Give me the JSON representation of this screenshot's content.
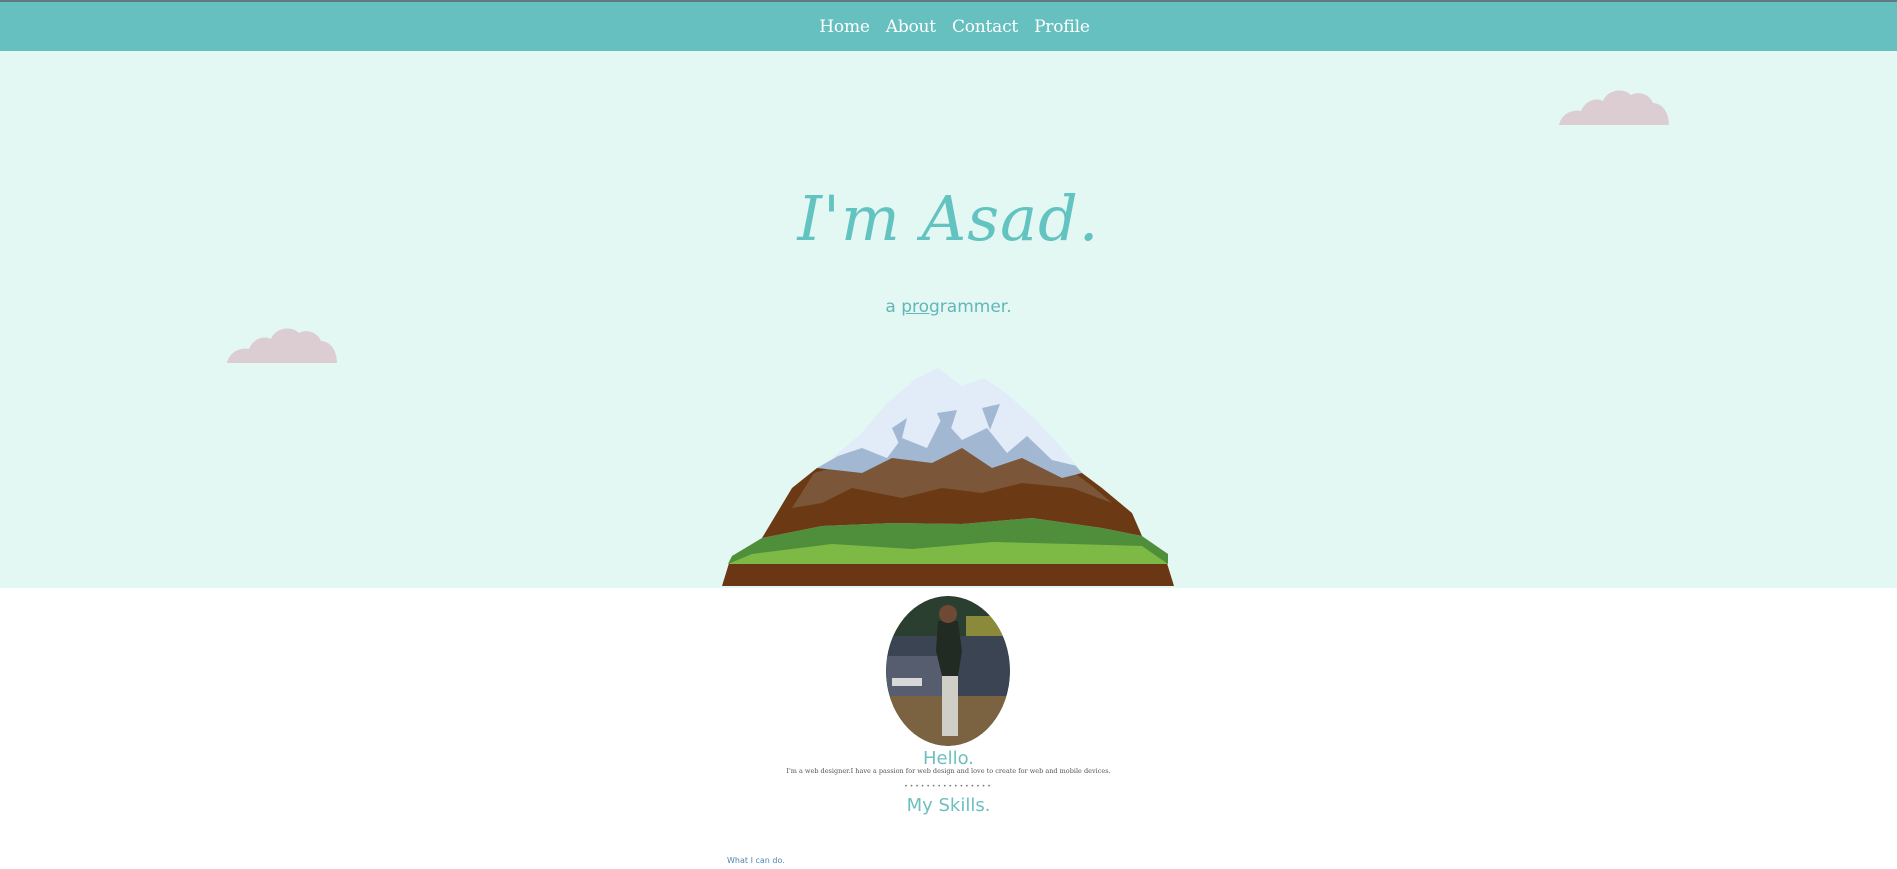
{
  "nav": {
    "items": [
      {
        "label": "Home"
      },
      {
        "label": "About"
      },
      {
        "label": "Contact"
      },
      {
        "label": "Profile"
      }
    ]
  },
  "hero": {
    "title": "I'm Asad.",
    "subtitle_prefix": "a ",
    "subtitle_underlined": "prog",
    "subtitle_rest": "rammer."
  },
  "about": {
    "heading": "Hello.",
    "intro": "I'm a web designer.I have a passion for web design and love to create for web and mobile devices.",
    "divider": "••••••••••••••••"
  },
  "skills": {
    "heading": "My Skills.",
    "subheading": "What I can do."
  },
  "colors": {
    "nav_bg": "#66c0c0",
    "hero_bg": "#e3f7f3",
    "accent": "#63c3c1",
    "cloud": "#dccdd3"
  }
}
